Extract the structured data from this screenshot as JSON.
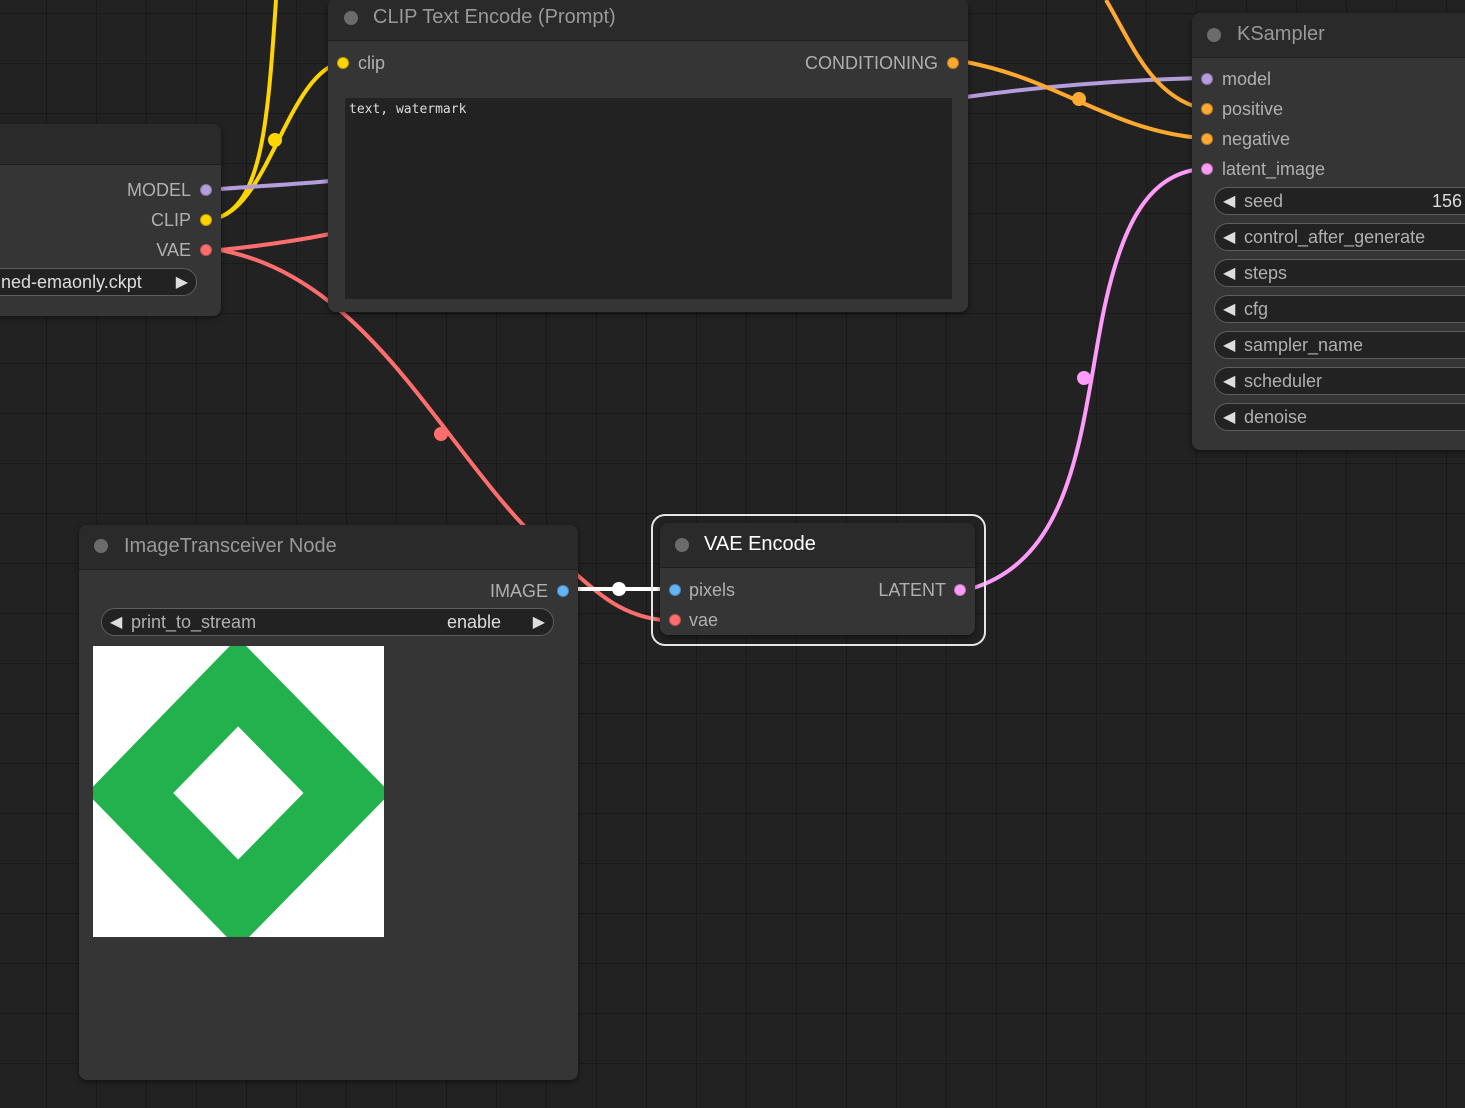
{
  "canvas": {
    "background": "#222222"
  },
  "link_colors": {
    "model": "#b39ddb",
    "clip": "#ffd500",
    "vae": "#ff6e6e",
    "conditioning": "#ffa931",
    "latent": "#ff9cf9",
    "image": "#ffffff"
  },
  "checkpoint_node": {
    "outputs": [
      {
        "label": "MODEL",
        "color": "#b39ddb"
      },
      {
        "label": "CLIP",
        "color": "#ffd500"
      },
      {
        "label": "VAE",
        "color": "#ff6e6e"
      }
    ],
    "ckpt_value": "ned-emaonly.ckpt",
    "right_arrow": "▶"
  },
  "clip_node": {
    "title": "CLIP Text Encode (Prompt)",
    "input": {
      "label": "clip",
      "color": "#ffd500"
    },
    "output": {
      "label": "CONDITIONING",
      "color": "#ffa931"
    },
    "text": "text, watermark"
  },
  "ksampler_node": {
    "title": "KSampler",
    "inputs": [
      {
        "label": "model",
        "color": "#b39ddb"
      },
      {
        "label": "positive",
        "color": "#ffa931"
      },
      {
        "label": "negative",
        "color": "#ffa931"
      },
      {
        "label": "latent_image",
        "color": "#ff9cf9"
      }
    ],
    "widgets": [
      {
        "label": "seed",
        "value": "156"
      },
      {
        "label": "control_after_generate",
        "value": ""
      },
      {
        "label": "steps",
        "value": ""
      },
      {
        "label": "cfg",
        "value": ""
      },
      {
        "label": "sampler_name",
        "value": ""
      },
      {
        "label": "scheduler",
        "value": ""
      },
      {
        "label": "denoise",
        "value": ""
      }
    ],
    "left_arrow": "◀"
  },
  "transceiver_node": {
    "title": "ImageTransceiver Node",
    "output": {
      "label": "IMAGE",
      "color": "#64b5f6"
    },
    "widget": {
      "label": "print_to_stream",
      "value": "enable",
      "left_arrow": "◀",
      "right_arrow": "▶"
    },
    "preview": {
      "shape": "diamond-outline",
      "stroke": "#22b14c",
      "background": "#ffffff"
    }
  },
  "vae_encode_node": {
    "title": "VAE Encode",
    "inputs": [
      {
        "label": "pixels",
        "color": "#64b5f6"
      },
      {
        "label": "vae",
        "color": "#ff6e6e"
      }
    ],
    "output": {
      "label": "LATENT",
      "color": "#ff9cf9"
    }
  }
}
